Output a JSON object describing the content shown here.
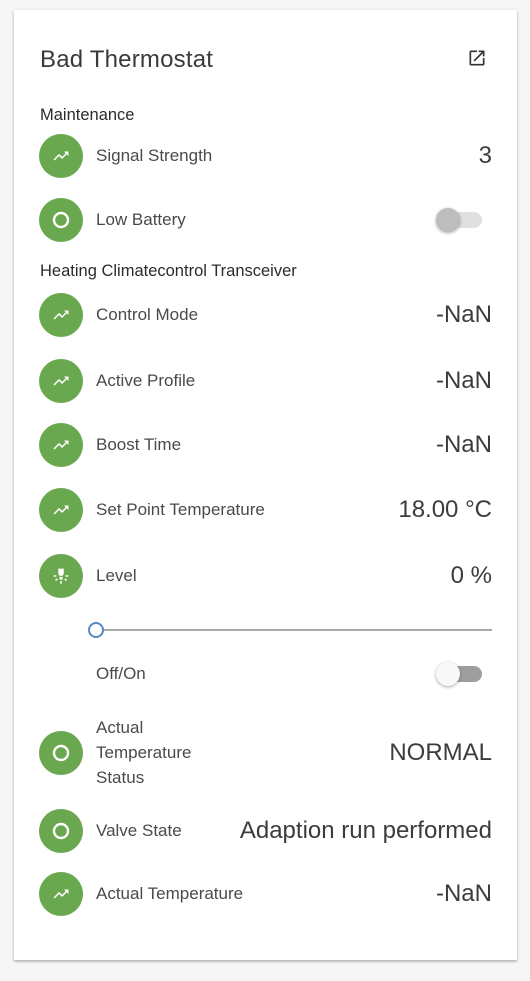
{
  "card": {
    "title": "Bad Thermostat"
  },
  "sections": {
    "maintenance": "Maintenance",
    "heating": "Heating Climatecontrol Transceiver"
  },
  "rows": {
    "signal_strength": {
      "label": "Signal Strength",
      "value": "3",
      "icon": "trend-icon"
    },
    "low_battery": {
      "label": "Low Battery",
      "icon": "circle-icon",
      "toggle_on": false
    },
    "control_mode": {
      "label": "Control Mode",
      "value": "-NaN",
      "icon": "trend-icon"
    },
    "active_profile": {
      "label": "Active Profile",
      "value": "-NaN",
      "icon": "trend-icon"
    },
    "boost_time": {
      "label": "Boost Time",
      "value": "-NaN",
      "icon": "trend-icon"
    },
    "set_point_temperature": {
      "label": "Set Point Temperature",
      "value": "18.00 °C",
      "icon": "trend-icon"
    },
    "level": {
      "label": "Level",
      "value": "0 %",
      "icon": "lightbulb-icon",
      "slider_value": 0
    },
    "off_on": {
      "label": "Off/On",
      "toggle_on": false
    },
    "actual_temperature_status": {
      "label": "Actual Temperature Status",
      "value": "NORMAL",
      "icon": "circle-icon"
    },
    "valve_state": {
      "label": "Valve State",
      "value": "Adaption run performed",
      "icon": "circle-icon"
    },
    "actual_temperature": {
      "label": "Actual Temperature",
      "value": "-NaN",
      "icon": "trend-icon"
    }
  },
  "colors": {
    "badge_green": "#6aa84f",
    "slider_accent": "#5b86c9",
    "toggle_track_off": "#e0e0e0",
    "toggle_track_dark": "#9e9e9e"
  }
}
